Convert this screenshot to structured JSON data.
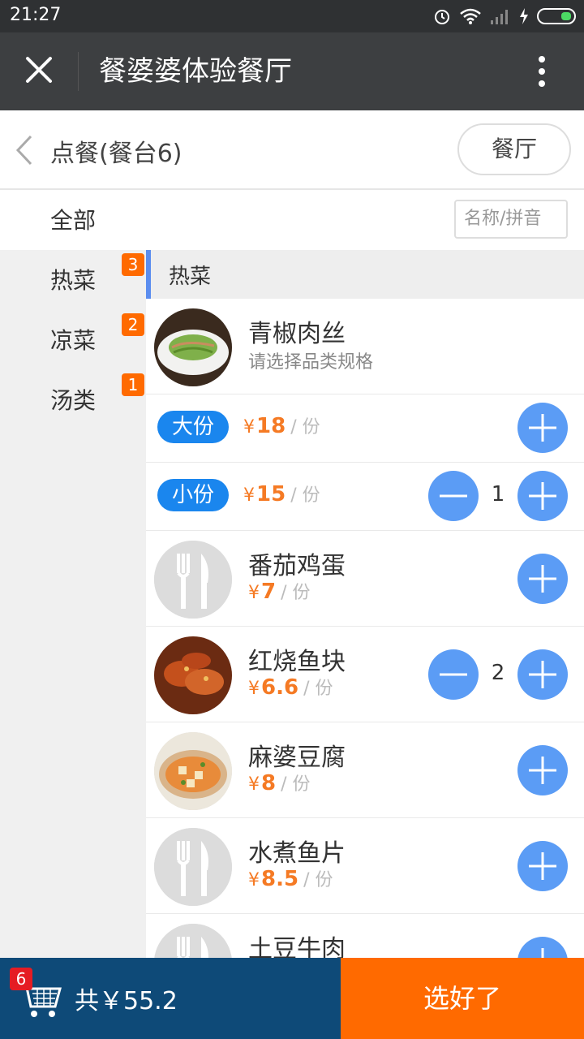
{
  "status_bar": {
    "time": "21:27"
  },
  "app_header": {
    "title": "餐婆婆体验餐厅"
  },
  "sub_header": {
    "title": "点餐(餐台6)",
    "restaurant_button": "餐厅"
  },
  "filter_row": {
    "all_label": "全部",
    "search_placeholder": "名称/拼音"
  },
  "categories": [
    {
      "name": "热菜",
      "badge": "3"
    },
    {
      "name": "凉菜",
      "badge": "2"
    },
    {
      "name": "汤类",
      "badge": "1"
    }
  ],
  "section_title": "热菜",
  "currency": "¥",
  "unit": "/ 份",
  "dishes": [
    {
      "name": "青椒肉丝",
      "hint": "请选择品类规格",
      "specs": [
        {
          "label": "大份",
          "price": "18",
          "qty": ""
        },
        {
          "label": "小份",
          "price": "15",
          "qty": "1"
        }
      ]
    },
    {
      "name": "番茄鸡蛋",
      "price": "7",
      "qty": ""
    },
    {
      "name": "红烧鱼块",
      "price": "6.6",
      "qty": "2"
    },
    {
      "name": "麻婆豆腐",
      "price": "8",
      "qty": ""
    },
    {
      "name": "水煮鱼片",
      "price": "8.5",
      "qty": ""
    },
    {
      "name": "土豆牛肉",
      "price": "",
      "qty": ""
    }
  ],
  "cart": {
    "badge": "6",
    "total_label": "共￥55.2"
  },
  "submit_label": "选好了",
  "colors": {
    "accent_orange": "#ff6a00",
    "price_orange": "#f57a24",
    "plus_blue": "#5b9cf5",
    "cart_bar": "#0e4a78"
  }
}
